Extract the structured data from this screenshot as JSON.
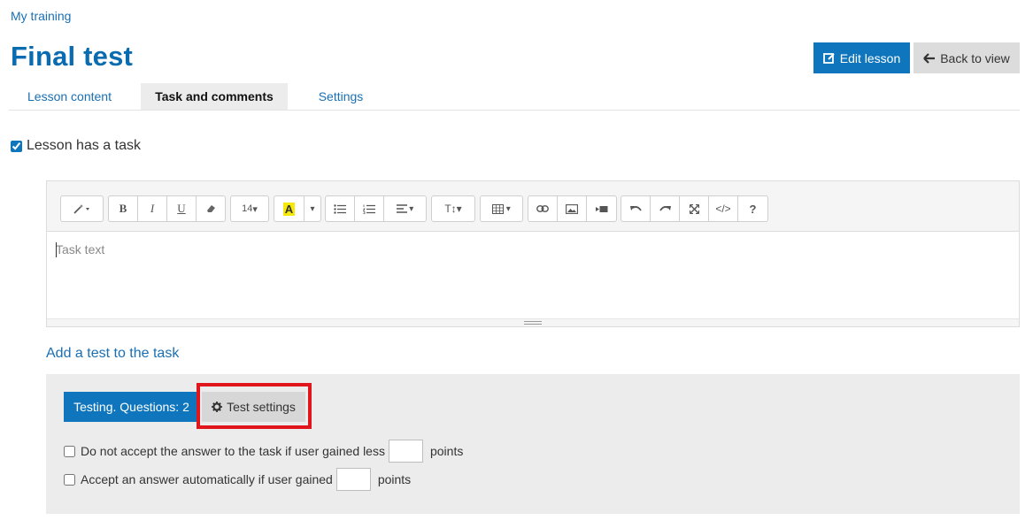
{
  "breadcrumb": "My training",
  "page_title": "Final test",
  "header_buttons": {
    "edit_lesson": "Edit lesson",
    "back_to_view": "Back to view"
  },
  "tabs": [
    {
      "label": "Lesson content",
      "active": false
    },
    {
      "label": "Task and comments",
      "active": true
    },
    {
      "label": "Settings",
      "active": false
    }
  ],
  "lesson_has_task": {
    "label": "Lesson has a task",
    "checked": true
  },
  "editor": {
    "placeholder": "Task text",
    "font_size": "14",
    "toolbar_icons": [
      "magic-wand-icon",
      "bold-icon",
      "italic-icon",
      "underline-icon",
      "eraser-icon",
      "font-size-dropdown",
      "highlight-color-icon",
      "color-dropdown-icon",
      "unordered-list-icon",
      "ordered-list-icon",
      "align-icon",
      "text-height-icon",
      "table-icon",
      "link-icon",
      "image-icon",
      "video-icon",
      "undo-icon",
      "redo-icon",
      "fullscreen-icon",
      "code-view-icon",
      "help-icon"
    ]
  },
  "add_test_link": "Add a test to the task",
  "test_panel": {
    "testing_button": "Testing. Questions: 2",
    "settings_button": "Test settings",
    "option1": {
      "label": "Do not accept the answer to the task if user gained less",
      "suffix": "points",
      "checked": false,
      "value": ""
    },
    "option2": {
      "label": "Accept an answer automatically if user gained",
      "suffix": "points",
      "checked": false,
      "value": ""
    }
  },
  "colors": {
    "primary": "#0f76bd",
    "link": "#1a6fb3",
    "highlight_border": "#e0161c",
    "highlight_yellow": "#f4e90a"
  }
}
